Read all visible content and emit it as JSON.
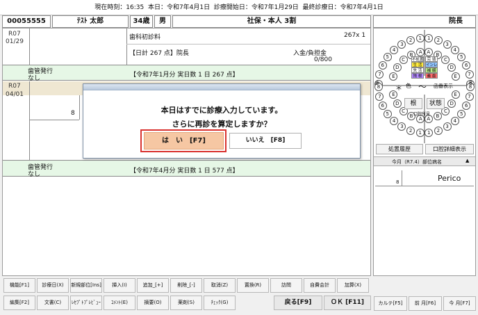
{
  "header": {
    "time_label": "現在時刻：",
    "time": "16:35",
    "today_label": "本日：",
    "today": "令和7年4月1日",
    "start_label": "診療開始日：",
    "start": "令和7年1月29日",
    "last_label": "最終診療日：",
    "last": "令和7年4月1日"
  },
  "patient": {
    "id": "00055555",
    "name": "ﾃｽﾄ 太郎",
    "age": "34歳",
    "sex": "男",
    "insurance": "社保・本人 3割",
    "doctor": "院長"
  },
  "records": {
    "r1_date_year": "R07",
    "r1_date_md": "01/29",
    "r1_item": "歯科初診料",
    "r1_points": "267x 1",
    "r1_summary": "【日計 267 点】院長",
    "r1_payment_label": "入金/負担金",
    "r1_payment_value": "0/800",
    "r1_note_line1": "歯管発行",
    "r1_note_line2": "なし",
    "r1_month_summary": "【令和7年1月分 実日数 1 日 267 点】",
    "r2_date_year": "R07",
    "r2_date_md": "04/01",
    "r2_tooth": "8",
    "r2_note_line1": "歯管発行",
    "r2_note_line2": "なし",
    "r2_month_summary": "【令和7年4月分 実日数 1 日 577 点】"
  },
  "dialog": {
    "message_line1": "本日はすでに診療入力しています。",
    "message_line2": "さらに再診を算定しますか？",
    "yes_label": "は　い　[F7]",
    "no_label": "いいえ　[F8]"
  },
  "tooth_chart": {
    "upper_right": [
      "8",
      "7",
      "6",
      "5",
      "4",
      "3",
      "2",
      "1"
    ],
    "upper_left": [
      "1",
      "2",
      "3",
      "4",
      "5",
      "6",
      "7",
      "8"
    ],
    "deciduous_upper_right": [
      "E",
      "D",
      "C",
      "B",
      "A"
    ],
    "deciduous_upper_left": [
      "A",
      "B",
      "C",
      "D",
      "E"
    ],
    "tags": [
      {
        "label": "不処置",
        "color": "#ffffff"
      },
      {
        "label": "完 填",
        "color": "#ffffff"
      },
      {
        "label": "生 活",
        "color": "#ffeb3b"
      },
      {
        "label": "インレー",
        "color": "#8fc3ff"
      },
      {
        "label": "失 活",
        "color": "#ffffff"
      },
      {
        "label": "補 綴",
        "color": "#b8e986"
      },
      {
        "label": "残 根",
        "color": "#b388ff"
      },
      {
        "label": "義 歯",
        "color": "#ff6b6b"
      }
    ],
    "mid_star": "＊",
    "mid_color": "色",
    "mid_tilde": "〜",
    "mid_display": "函番表示",
    "root_label": "根",
    "status_label": "状態",
    "oral_label": "口腔所見",
    "midline_left": "8",
    "midline_right": "8"
  },
  "side": {
    "history_button": "処置履歴",
    "oral_detail_button": "口腔詳細表示",
    "today_section": "今月（R7.4）部位病名",
    "tooth_num": "8",
    "disease": "Perico"
  },
  "footer": {
    "row1": [
      "機能[F1]",
      "診療日(X)",
      "新規部位[Ins]",
      "挿入(I)",
      "追加_[+]",
      "削除_[-]",
      "取消(Z)",
      "置換(R)",
      "訪問",
      "自費会計",
      "加算(X)"
    ],
    "row2": [
      "編集[F2]",
      "文書(C)",
      "ﾚｾﾌﾟﾄﾌﾟﾚﾋﾞｭｰ",
      "ｺﾒﾝﾄ(E)",
      "摘要(O)",
      "薬剤(S)",
      "ﾁｪｯｸ(G)"
    ],
    "back_label": "戻る[F9]",
    "ok_label": "ＯＫ [F11]",
    "karte_label": "カルテ[F5]",
    "prev_label": "前 月[F6]",
    "this_label": "今 月[F7]"
  }
}
